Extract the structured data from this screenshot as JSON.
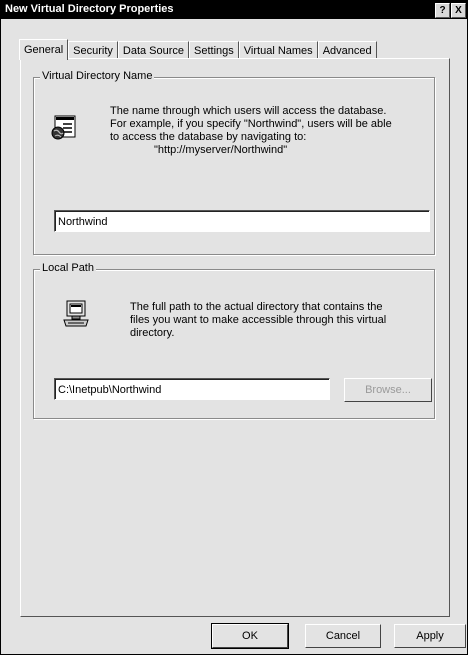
{
  "window": {
    "title": "New Virtual Directory Properties",
    "help_glyph": "?",
    "close_glyph": "X"
  },
  "tabs": [
    "General",
    "Security",
    "Data Source",
    "Settings",
    "Virtual Names",
    "Advanced"
  ],
  "active_tab": "General",
  "virtual_directory_group": {
    "title": "Virtual Directory Name",
    "line1": "The name through which users will access the database.",
    "line2": "For example, if you specify \"Northwind\", users will be able",
    "line3": "to access the database by navigating to:",
    "line4": "\"http://myserver/Northwind\"",
    "name_value": "Northwind",
    "icon": "web-directory-icon"
  },
  "local_path_group": {
    "title": "Local Path",
    "line1": "The full path to the actual directory that contains the",
    "line2": "files you want to make accessible through this virtual",
    "line3": "directory.",
    "path_value": "C:\\Inetpub\\Northwind",
    "browse_label": "Browse...",
    "icon": "computer-icon"
  },
  "buttons": {
    "ok": "OK",
    "cancel": "Cancel",
    "apply": "Apply"
  }
}
